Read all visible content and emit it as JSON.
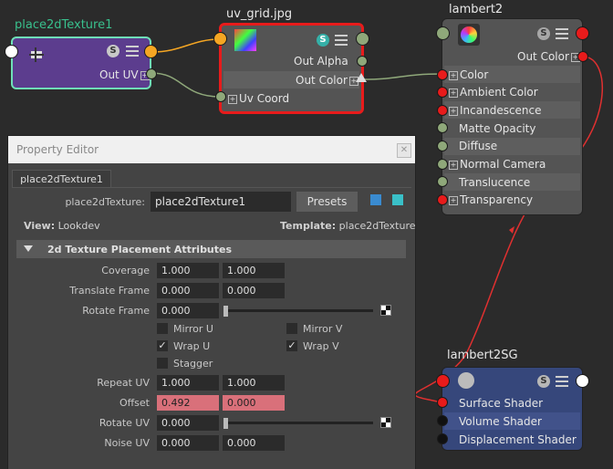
{
  "nodes": {
    "place2d": {
      "title": "place2dTexture1",
      "out_uv": "Out UV",
      "colors": {
        "title": "#39c08d",
        "body": "#5c3d8e",
        "border": "#6fe0b8"
      }
    },
    "uvgrid": {
      "title": "uv_grid.jpg",
      "out_alpha": "Out Alpha",
      "out_color": "Out Color",
      "uv_coord": "Uv Coord",
      "colors": {
        "body": "#545454",
        "border": "#e81b1b"
      }
    },
    "lambert2": {
      "title": "lambert2",
      "out_color": "Out Color",
      "attrs": [
        "Color",
        "Ambient Color",
        "Incandescence",
        "Matte Opacity",
        "Diffuse",
        "Normal Camera",
        "Translucence",
        "Transparency"
      ]
    },
    "lambert2sg": {
      "title": "lambert2SG",
      "attrs": [
        "Surface Shader",
        "Volume Shader",
        "Displacement Shader"
      ],
      "colors": {
        "body": "#36477b"
      }
    }
  },
  "property_editor": {
    "window_title": "Property Editor",
    "tab": "place2dTexture1",
    "node_label": "place2dTexture:",
    "node_value": "place2dTexture1",
    "presets_label": "Presets",
    "view_label": "View:",
    "view_value": "Lookdev",
    "template_label": "Template:",
    "template_value": "place2dTexture",
    "section_title": "2d Texture Placement Attributes",
    "coverage": {
      "label": "Coverage",
      "v1": "1.000",
      "v2": "1.000"
    },
    "translate_frame": {
      "label": "Translate Frame",
      "v1": "0.000",
      "v2": "0.000"
    },
    "rotate_frame": {
      "label": "Rotate Frame",
      "v1": "0.000"
    },
    "mirror_u": {
      "label": "Mirror U",
      "checked": false
    },
    "mirror_v": {
      "label": "Mirror V",
      "checked": false
    },
    "wrap_u": {
      "label": "Wrap U",
      "checked": true
    },
    "wrap_v": {
      "label": "Wrap V",
      "checked": true
    },
    "stagger": {
      "label": "Stagger",
      "checked": false
    },
    "repeat_uv": {
      "label": "Repeat UV",
      "v1": "1.000",
      "v2": "1.000"
    },
    "offset": {
      "label": "Offset",
      "v1": "0.492",
      "v2": "0.000"
    },
    "rotate_uv": {
      "label": "Rotate UV",
      "v1": "0.000"
    },
    "noise_uv": {
      "label": "Noise UV",
      "v1": "0.000",
      "v2": "0.000"
    },
    "checkmark": "✓"
  },
  "colors": {
    "background": "#2b2b2b",
    "connection_red": "#e03030",
    "connection_green": "#8fa87a",
    "connection_orange": "#f5a623"
  }
}
